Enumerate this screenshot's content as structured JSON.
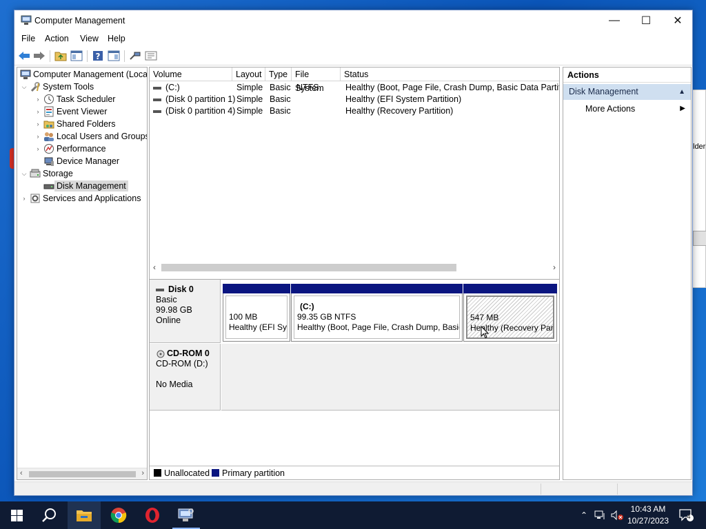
{
  "window": {
    "title": "Computer Management",
    "controls": {
      "minimize": "—",
      "maximize": "☐",
      "close": "✕"
    }
  },
  "menu": [
    "File",
    "Action",
    "View",
    "Help"
  ],
  "toolbar": {
    "icons": [
      "back-icon",
      "forward-icon",
      "up-folder-icon",
      "show-hide-console-tree-icon",
      "help-icon",
      "show-hide-action-pane-icon",
      "connect-icon",
      "properties-icon"
    ]
  },
  "tree": {
    "root": "Computer Management (Local",
    "items": [
      {
        "label": "System Tools",
        "icon": "tools-icon"
      },
      {
        "label": "Task Scheduler",
        "icon": "clock-icon"
      },
      {
        "label": "Event Viewer",
        "icon": "event-viewer-icon"
      },
      {
        "label": "Shared Folders",
        "icon": "shared-folder-icon"
      },
      {
        "label": "Local Users and Groups",
        "icon": "users-icon"
      },
      {
        "label": "Performance",
        "icon": "performance-icon"
      },
      {
        "label": "Device Manager",
        "icon": "device-manager-icon"
      },
      {
        "label": "Storage",
        "icon": "storage-icon"
      },
      {
        "label": "Disk Management",
        "icon": "disk-icon",
        "selected": true
      },
      {
        "label": "Services and Applications",
        "icon": "services-icon"
      }
    ]
  },
  "volumes": {
    "columns": [
      "Volume",
      "Layout",
      "Type",
      "File System",
      "Status"
    ],
    "rows": [
      {
        "volume": "(C:)",
        "layout": "Simple",
        "type": "Basic",
        "fs": "NTFS",
        "status": "Healthy (Boot, Page File, Crash Dump, Basic Data Partition)"
      },
      {
        "volume": "(Disk 0 partition 1)",
        "layout": "Simple",
        "type": "Basic",
        "fs": "",
        "status": "Healthy (EFI System Partition)"
      },
      {
        "volume": "(Disk 0 partition 4)",
        "layout": "Simple",
        "type": "Basic",
        "fs": "",
        "status": "Healthy (Recovery Partition)"
      }
    ]
  },
  "disks": [
    {
      "name": "Disk 0",
      "lines": [
        "Basic",
        "99.98 GB",
        "Online"
      ],
      "partitions": [
        {
          "title": "",
          "size": "100 MB",
          "status": "Healthy (EFI Sys"
        },
        {
          "title": "(C:)",
          "size": "99.35 GB NTFS",
          "status": "Healthy (Boot, Page File, Crash Dump, Basic"
        },
        {
          "title": "",
          "size": "547 MB",
          "status": "Healthy (Recovery Parti"
        }
      ]
    },
    {
      "name": "CD-ROM 0",
      "lines": [
        "CD-ROM (D:)",
        "",
        "No Media"
      ]
    }
  ],
  "legend": {
    "unallocated": "Unallocated",
    "primary": "Primary partition",
    "colors": {
      "unallocated": "#000000",
      "primary": "#0a1580"
    }
  },
  "actions": {
    "title": "Actions",
    "group": "Disk Management",
    "more": "More Actions"
  },
  "background_window": {
    "fragment": "lder"
  },
  "taskbar": {
    "apps": [
      "start-icon",
      "search-icon",
      "file-explorer-icon",
      "chrome-icon",
      "opera-icon",
      "computer-management-icon"
    ],
    "time": "10:43 AM",
    "date": "10/27/2023",
    "notifications": "4"
  }
}
